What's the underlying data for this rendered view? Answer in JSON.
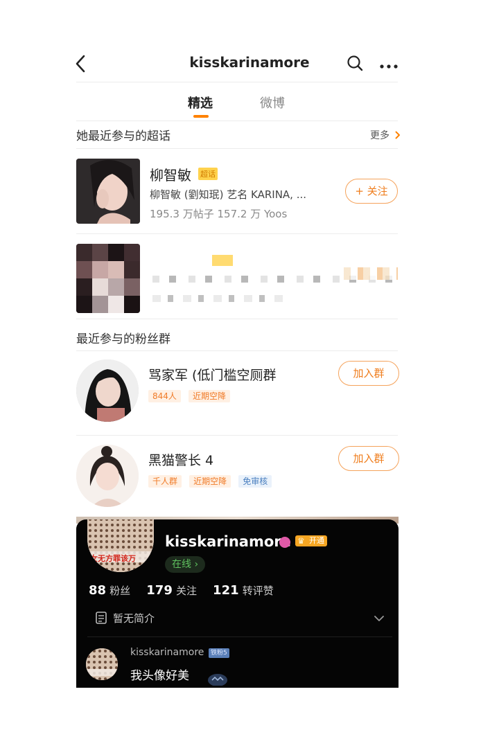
{
  "header": {
    "title": "kisskarinamore"
  },
  "tabs": [
    {
      "label": "精选",
      "active": true
    },
    {
      "label": "微博",
      "active": false
    }
  ],
  "supertopics": {
    "section_title": "她最近参与的超话",
    "more_label": "更多",
    "items": [
      {
        "name": "柳智敏",
        "badge": "超话",
        "description": "柳智敏 (劉知珉) 艺名 KARINA, ...",
        "stats": "195.3 万帖子 157.2 万 Yoos",
        "follow_label": "+ 关注"
      }
    ]
  },
  "fangroups": {
    "section_title": "最近参与的粉丝群",
    "items": [
      {
        "name": "骂家军 (低门槛空厕群",
        "tags": [
          {
            "text": "844人",
            "style": "orange"
          },
          {
            "text": "近期空降",
            "style": "orange"
          }
        ],
        "join_label": "加入群"
      },
      {
        "name": "黑猫警长 4",
        "tags": [
          {
            "text": "千人群",
            "style": "orange"
          },
          {
            "text": "近期空降",
            "style": "orange"
          },
          {
            "text": "免审核",
            "style": "blue"
          }
        ],
        "join_label": "加入群"
      }
    ]
  },
  "profile_card": {
    "username": "kisskarinamore",
    "vip_label": "开通",
    "online_label": "在线 ›",
    "avatar_banner": "女无方罪该万",
    "stats": [
      {
        "value": "88",
        "label": "粉丝"
      },
      {
        "value": "179",
        "label": "关注"
      },
      {
        "value": "121",
        "label": "转评赞"
      }
    ],
    "bio": "暂无简介",
    "comment": {
      "username": "kisskarinamore",
      "fan_badge": "铁粉5",
      "text": "我头像好美"
    }
  },
  "colors": {
    "accent": "#ff8200",
    "tag_orange_bg": "#fff0e3",
    "tag_blue_bg": "#eaf2fb",
    "card_bg": "#050505"
  }
}
